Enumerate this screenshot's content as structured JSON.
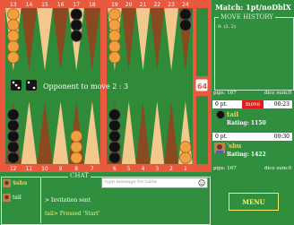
{
  "match": {
    "title": "Match: 1pt/noDblX"
  },
  "move_history": {
    "legend": "MOVE HISTORY",
    "text": "8: (2, 2)"
  },
  "board": {
    "top_numbers": [
      "13",
      "14",
      "15",
      "16",
      "17",
      "18",
      "19",
      "20",
      "21",
      "22",
      "23",
      "24"
    ],
    "bottom_numbers": [
      "12",
      "11",
      "10",
      "9",
      "8",
      "7",
      "6",
      "5",
      "4",
      "3",
      "2",
      "1"
    ],
    "message": "Opponent to move 2 : 3",
    "cube": "64"
  },
  "players": {
    "top": {
      "pips": "pips: 167",
      "dice_sum": "dice sum:0",
      "score": "0 pt.",
      "status": "move",
      "time": "00:23",
      "name": "tail",
      "rating": "Rating: 1150"
    },
    "bottom": {
      "pips": "pips: 167",
      "dice_sum": "dice sum:0",
      "score": "0 pt.",
      "time": "00:30",
      "name": "'shu",
      "rating": "Rating: 1422"
    }
  },
  "chat": {
    "legend": "CHAT",
    "placeholder": "type message for table",
    "users": [
      "$shu",
      "tail"
    ],
    "messages": [
      "> Invitation sent",
      "tail> Pressed 'Start'"
    ]
  },
  "menu": {
    "label": "MENU"
  },
  "colors": {
    "board_red": "#e8593e",
    "felt": "#2f8f3e",
    "menu": "#f4f36a"
  }
}
